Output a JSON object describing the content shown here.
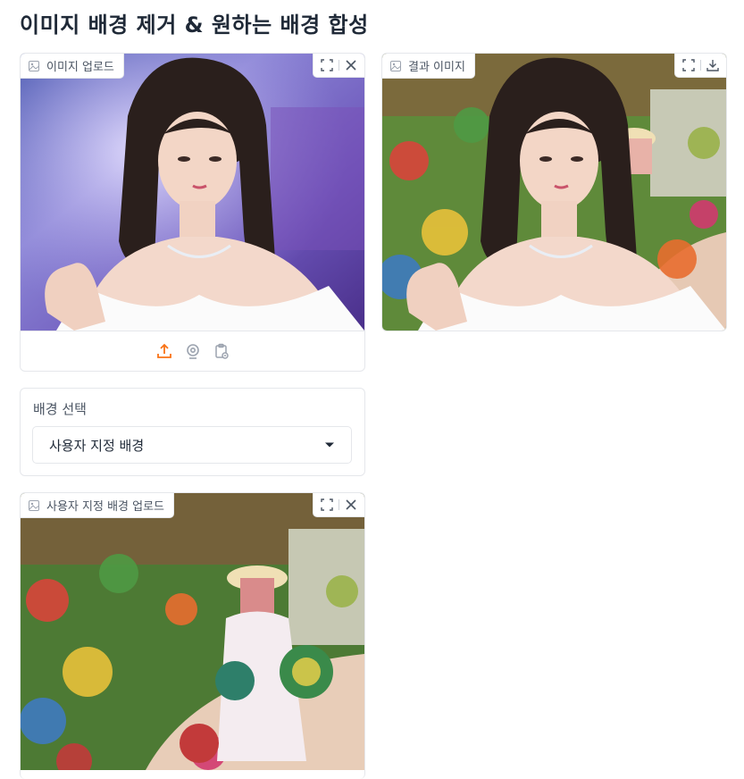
{
  "page": {
    "title": "이미지 배경 제거 & 원하는 배경 합성"
  },
  "upload_panel": {
    "label": "이미지 업로드",
    "label_icon": "image-icon",
    "tools": [
      "fullscreen-icon",
      "close-icon"
    ],
    "sources": [
      "upload-icon",
      "webcam-icon",
      "clipboard-icon"
    ]
  },
  "result_panel": {
    "label": "결과 이미지",
    "label_icon": "image-icon",
    "tools": [
      "fullscreen-icon",
      "download-icon"
    ]
  },
  "background_select": {
    "label": "배경 선택",
    "selected": "사용자 지정 배경"
  },
  "custom_bg_panel": {
    "label": "사용자 지정 배경 업로드",
    "label_icon": "image-icon",
    "tools": [
      "fullscreen-icon",
      "close-icon"
    ]
  },
  "colors": {
    "accent": "#f97316",
    "border": "#e5e7eb",
    "text": "#1f2937"
  }
}
